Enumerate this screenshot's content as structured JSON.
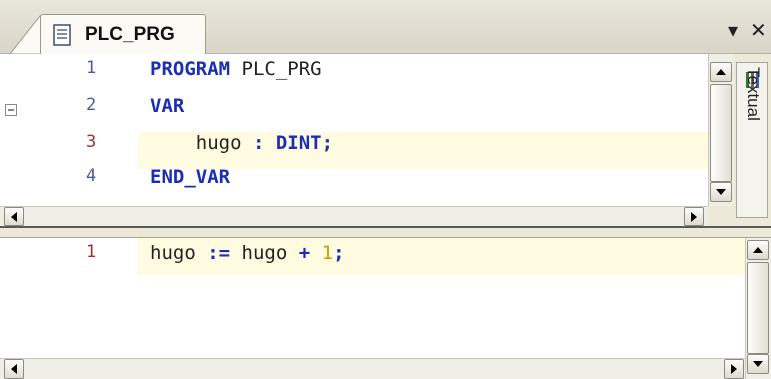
{
  "editor": {
    "tab_label": "PLC_PRG",
    "controls": {
      "dropdown": "▾",
      "close": "✕"
    }
  },
  "declaration": {
    "lines": [
      {
        "number": "1",
        "tokens": [
          {
            "t": "PROGRAM",
            "c": "kw"
          },
          {
            "t": " PLC_PRG",
            "c": ""
          }
        ]
      },
      {
        "number": "2",
        "tokens": [
          {
            "t": "VAR",
            "c": "kw"
          }
        ]
      },
      {
        "number": "3",
        "tokens": [
          {
            "t": "    hugo ",
            "c": ""
          },
          {
            "t": ":",
            "c": "op"
          },
          {
            "t": " ",
            "c": ""
          },
          {
            "t": "DINT",
            "c": "kw"
          },
          {
            "t": ";",
            "c": "op"
          }
        ]
      },
      {
        "number": "4",
        "tokens": [
          {
            "t": "END_VAR",
            "c": "kw"
          }
        ]
      }
    ],
    "highlighted_line": 3
  },
  "implementation": {
    "lines": [
      {
        "number": "1",
        "tokens": [
          {
            "t": "hugo ",
            "c": ""
          },
          {
            "t": ":=",
            "c": "op"
          },
          {
            "t": " hugo ",
            "c": ""
          },
          {
            "t": "+",
            "c": "op"
          },
          {
            "t": " ",
            "c": ""
          },
          {
            "t": "1",
            "c": "num"
          },
          {
            "t": ";",
            "c": "op"
          }
        ]
      }
    ],
    "highlighted_line": 1
  },
  "side_panel": {
    "label": "Textual"
  },
  "icons": [
    "document-icon",
    "collapse-minus-icon",
    "toolbox-icon",
    "dropdown-arrow-icon",
    "close-icon"
  ]
}
